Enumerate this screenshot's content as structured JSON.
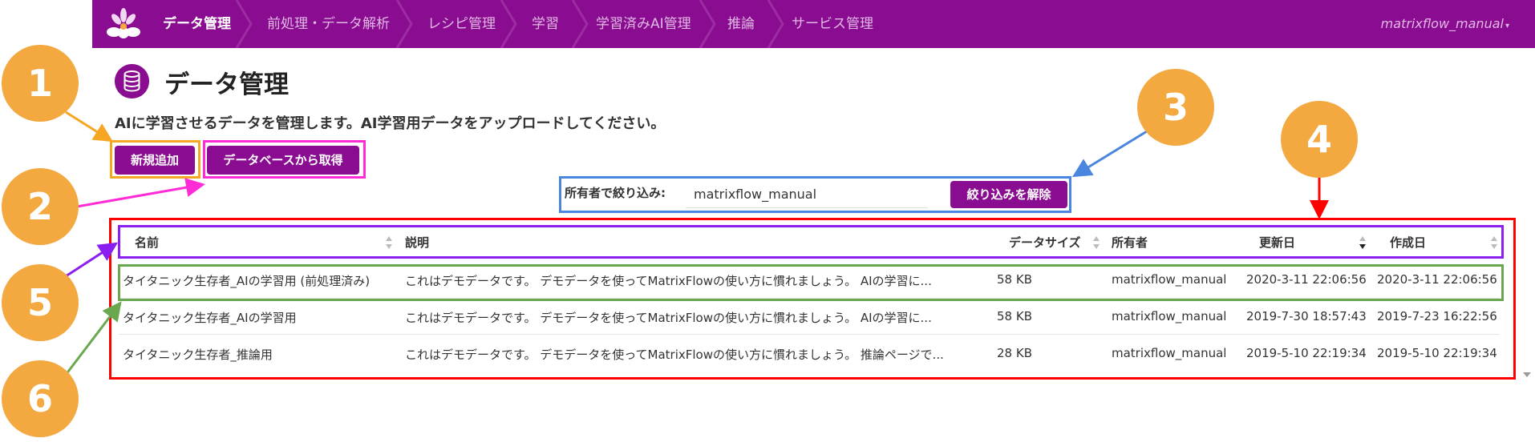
{
  "nav": {
    "items": [
      {
        "label": "データ管理",
        "active": true
      },
      {
        "label": "前処理・データ解析",
        "active": false
      },
      {
        "label": "レシピ管理",
        "active": false
      },
      {
        "label": "学習",
        "active": false
      },
      {
        "label": "学習済みAI管理",
        "active": false
      },
      {
        "label": "推論",
        "active": false
      },
      {
        "label": "サービス管理",
        "active": false
      }
    ],
    "user": "matrixflow_manual"
  },
  "page": {
    "title": "データ管理",
    "description": "AIに学習させるデータを管理します。AI学習用データをアップロードしてください。"
  },
  "buttons": {
    "new": "新規追加",
    "from_db": "データベースから取得",
    "clear_filter": "絞り込みを解除"
  },
  "filter": {
    "label": "所有者で絞り込み:",
    "value": "matrixflow_manual"
  },
  "table": {
    "headers": {
      "name": "名前",
      "description": "説明",
      "size": "データサイズ",
      "owner": "所有者",
      "updated": "更新日",
      "created": "作成日"
    },
    "rows": [
      {
        "name": "タイタニック生存者_AIの学習用 (前処理済み)",
        "description": "これはデモデータです。 デモデータを使ってMatrixFlowの使い方に慣れましょう。 AIの学習に...",
        "size": "58 KB",
        "owner": "matrixflow_manual",
        "updated": "2020-3-11 22:06:56",
        "created": "2020-3-11 22:06:56"
      },
      {
        "name": "タイタニック生存者_AIの学習用",
        "description": "これはデモデータです。 デモデータを使ってMatrixFlowの使い方に慣れましょう。 AIの学習に...",
        "size": "58 KB",
        "owner": "matrixflow_manual",
        "updated": "2019-7-30 18:57:43",
        "created": "2019-7-23 16:22:56"
      },
      {
        "name": "タイタニック生存者_推論用",
        "description": "これはデモデータです。 デモデータを使ってMatrixFlowの使い方に慣れましょう。 推論ページで...",
        "size": "28 KB",
        "owner": "matrixflow_manual",
        "updated": "2019-5-10 22:19:34",
        "created": "2019-5-10 22:19:34"
      }
    ]
  },
  "annotations": [
    "1",
    "2",
    "3",
    "4",
    "5",
    "6"
  ],
  "colors": {
    "brand_purple": "#8a0c91",
    "nav_inactive_text": "#e2b9e5",
    "annotation_orange": "#f4a840",
    "box_orange": "#f5a623",
    "box_magenta": "#ff2bd7",
    "box_blue": "#4a86e0",
    "box_red": "#ff0000",
    "box_violet": "#8b1ef0",
    "box_green": "#6aa84f"
  },
  "icons": [
    "logo-icon",
    "database-icon",
    "chevron-separator-icon",
    "caret-down-icon",
    "sort-icon",
    "scroll-down-icon"
  ]
}
